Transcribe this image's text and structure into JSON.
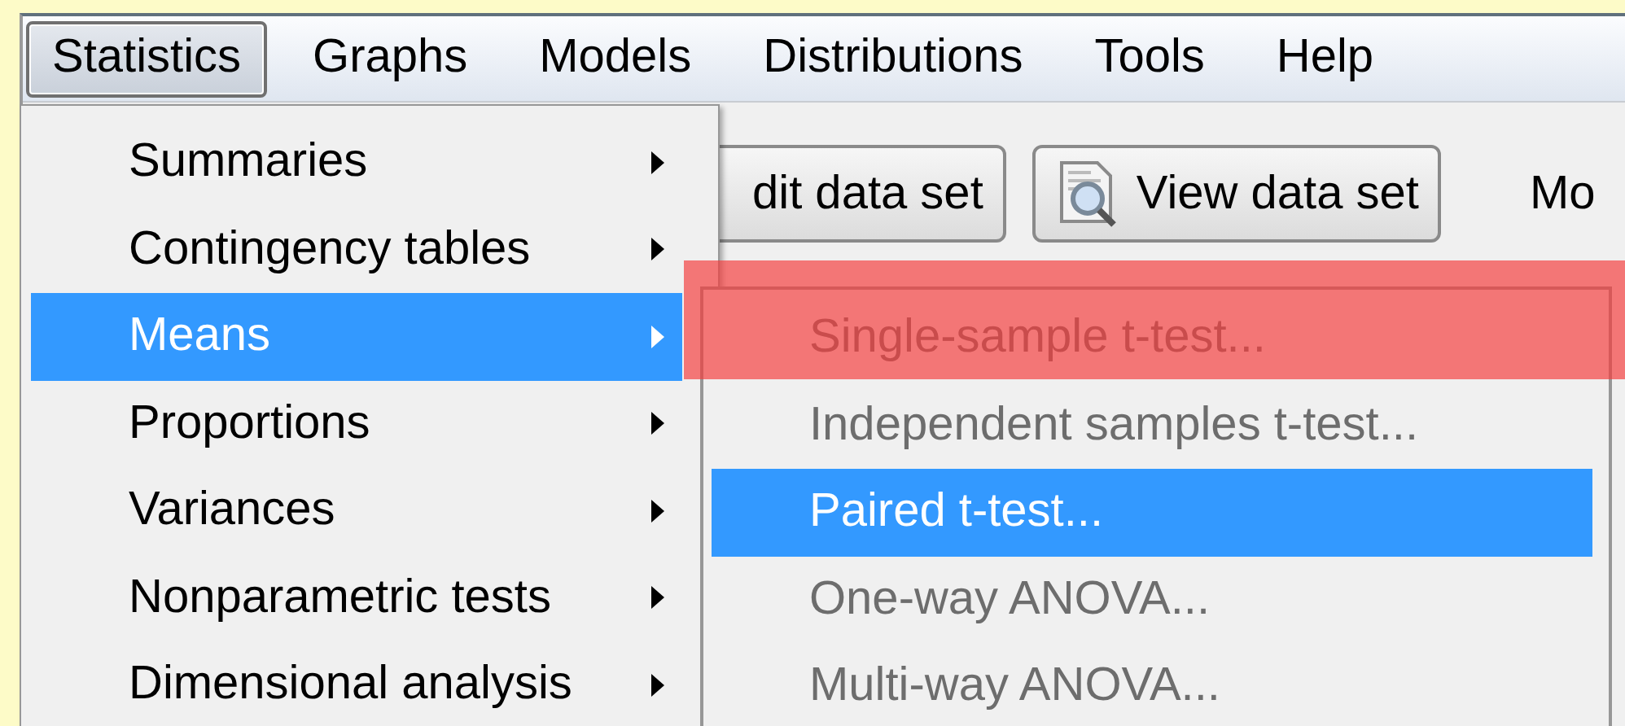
{
  "menubar": [
    {
      "label": "Statistics",
      "selected": true
    },
    {
      "label": "Graphs",
      "selected": false
    },
    {
      "label": "Models",
      "selected": false
    },
    {
      "label": "Distributions",
      "selected": false
    },
    {
      "label": "Tools",
      "selected": false
    },
    {
      "label": "Help",
      "selected": false
    }
  ],
  "toolbar": {
    "buttons": [
      {
        "label": "dit data set",
        "kind": "plain"
      },
      {
        "label": "View data set",
        "kind": "icon"
      }
    ],
    "label": "Mo"
  },
  "menu": {
    "items": [
      {
        "label": "Summaries",
        "selected": false,
        "submenu": true
      },
      {
        "label": "Contingency tables",
        "selected": false,
        "submenu": true
      },
      {
        "label": "Means",
        "selected": true,
        "submenu": true
      },
      {
        "label": "Proportions",
        "selected": false,
        "submenu": true
      },
      {
        "label": "Variances",
        "selected": false,
        "submenu": true
      },
      {
        "label": "Nonparametric tests",
        "selected": false,
        "submenu": true
      },
      {
        "label": "Dimensional analysis",
        "selected": false,
        "submenu": true
      }
    ]
  },
  "submenu": {
    "items": [
      {
        "label": "Single-sample t-test...",
        "disabled": true,
        "selected": false,
        "annotated": true
      },
      {
        "label": "Independent samples t-test...",
        "disabled": true,
        "selected": false,
        "annotated": false
      },
      {
        "label": "Paired t-test...",
        "disabled": false,
        "selected": true,
        "annotated": false
      },
      {
        "label": "One-way ANOVA...",
        "disabled": true,
        "selected": false,
        "annotated": false
      },
      {
        "label": "Multi-way ANOVA...",
        "disabled": true,
        "selected": false,
        "annotated": false
      }
    ]
  }
}
